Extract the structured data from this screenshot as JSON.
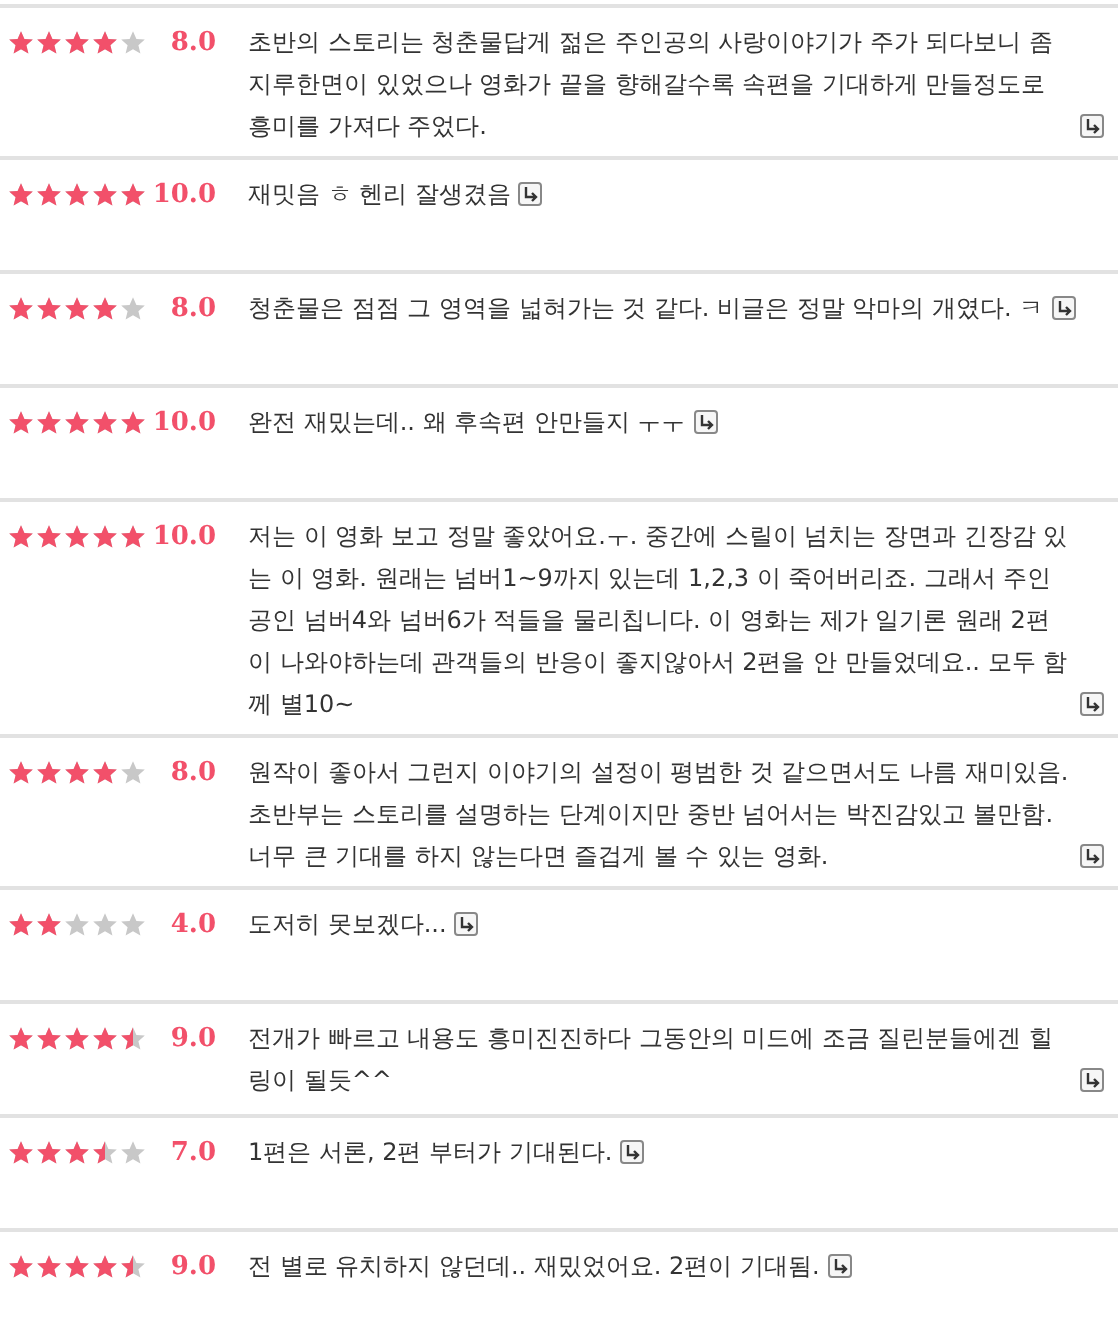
{
  "reviews": [
    {
      "stars": 4,
      "score": "8.0",
      "text": "초반의 스토리는 청춘물답게 젊은 주인공의 사랑이야기가 주가 되다보니 좀 지루한면이 있었으나 영화가 끝을 향해갈수록 속편을 기대하게 만들정도로 흥미를 가져다 주었다."
    },
    {
      "stars": 5,
      "score": "10.0",
      "text": "재밋음 ㅎ 헨리 잘생겼음"
    },
    {
      "stars": 4,
      "score": "8.0",
      "text": "청춘물은 점점 그 영역을 넓혀가는 것 같다. 비글은 정말 악마의 개였다. ㅋ"
    },
    {
      "stars": 5,
      "score": "10.0",
      "text": "완전 재밌는데.. 왜 후속편 안만들지 ㅜㅜ"
    },
    {
      "stars": 5,
      "score": "10.0",
      "text": "저는 이 영화 보고 정말 좋았어요.ㅜ. 중간에 스릴이 넘치는 장면과 긴장감 있는 이 영화. 원래는 넘버1~9까지 있는데 1,2,3 이 죽어버리죠. 그래서 주인공인 넘버4와 넘버6가 적들을 물리칩니다. 이 영화는 제가 일기론 원래 2편이 나와야하는데 관객들의 반응이 좋지않아서 2편을 안 만들었데요.. 모두 함께 별10~"
    },
    {
      "stars": 4,
      "score": "8.0",
      "text": "원작이 좋아서 그런지 이야기의 설정이 평범한 것 같으면서도 나름 재미있음. 초반부는 스토리를 설명하는 단계이지만 중반 넘어서는 박진감있고 볼만함. 너무 큰 기대를 하지 않는다면 즐겁게 볼 수 있는 영화."
    },
    {
      "stars": 2,
      "score": "4.0",
      "text": "도저히 못보겠다..."
    },
    {
      "stars": 4.5,
      "score": "9.0",
      "text": "전개가 빠르고 내용도 흥미진진하다 그동안의 미드에 조금 질린분들에겐 힐링이 될듯^^"
    },
    {
      "stars": 3.5,
      "score": "7.0",
      "text": "1편은 서론, 2편 부터가 기대된다."
    },
    {
      "stars": 4.5,
      "score": "9.0",
      "text": "전 별로 유치하지 않던데.. 재밌었어요. 2편이 기대됨."
    }
  ]
}
